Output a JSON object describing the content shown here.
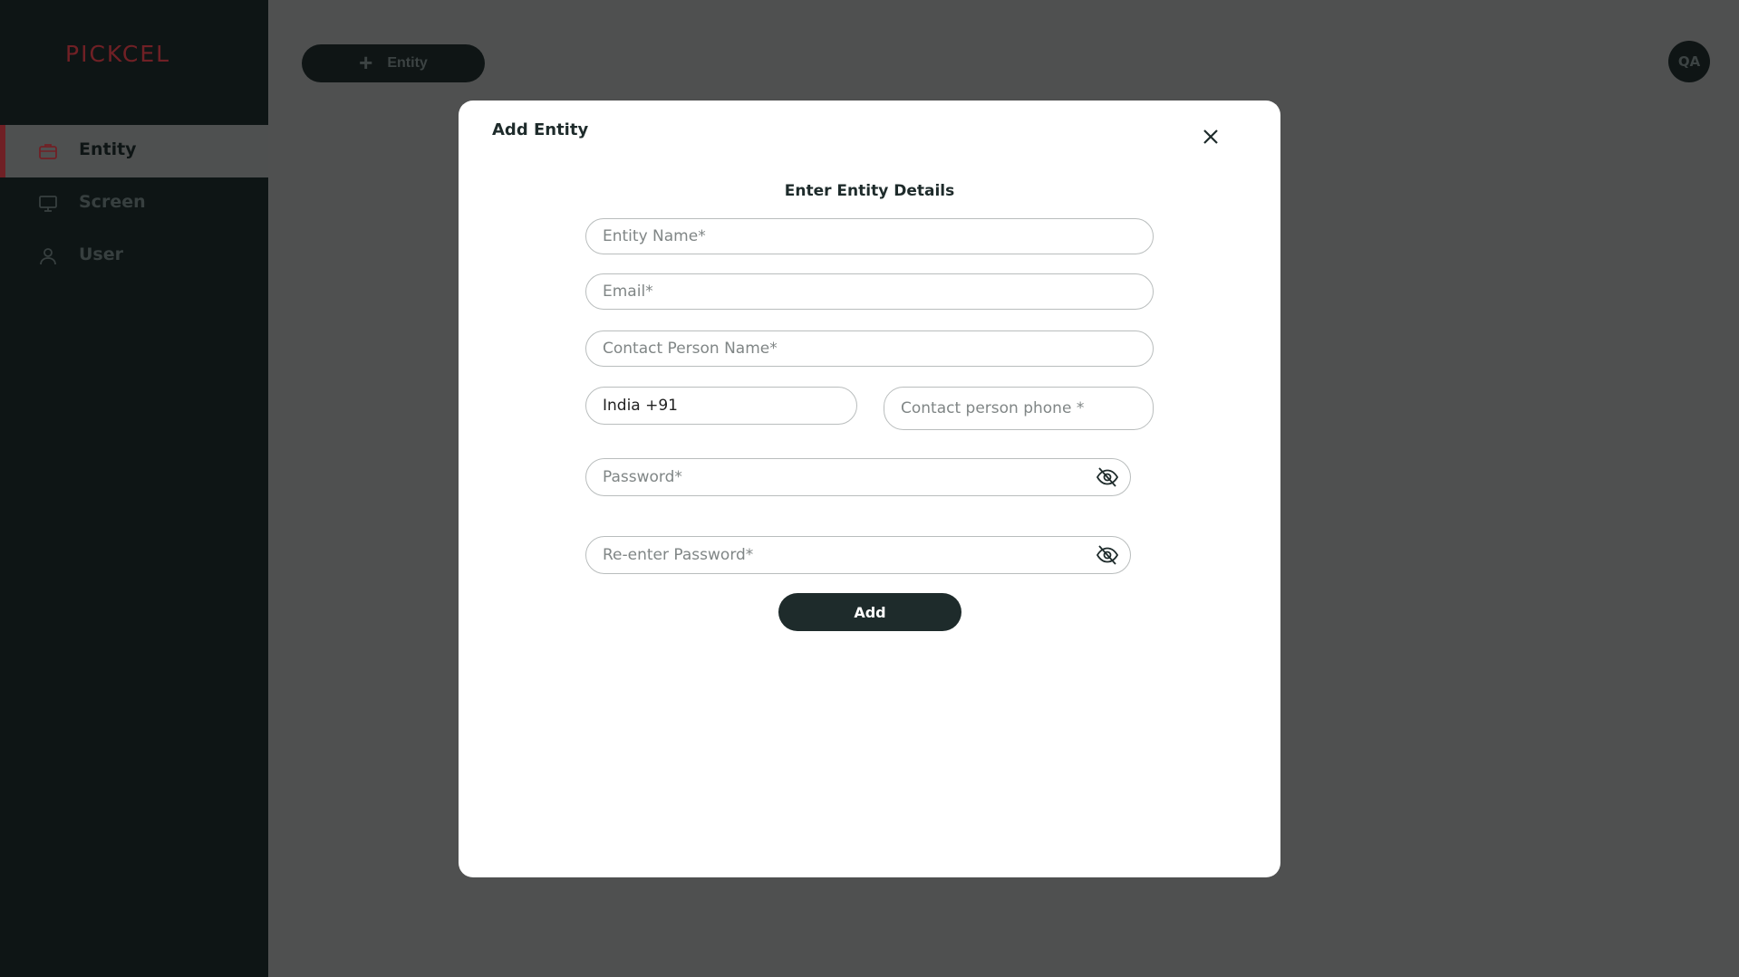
{
  "app": {
    "logo_text": "PICKCEL"
  },
  "sidebar": {
    "items": [
      {
        "label": "Entity",
        "icon": "briefcase-icon",
        "active": true
      },
      {
        "label": "Screen",
        "icon": "monitor-icon",
        "active": false
      },
      {
        "label": "User",
        "icon": "user-icon",
        "active": false
      }
    ]
  },
  "header": {
    "add_button_label": "Entity",
    "avatar_initials": "QA"
  },
  "modal": {
    "title": "Add Entity",
    "section_title": "Enter Entity Details",
    "fields": {
      "entity_name_placeholder": "Entity Name*",
      "email_placeholder": "Email*",
      "contact_person_placeholder": "Contact Person Name*",
      "country_code_value": "India +91",
      "phone_placeholder": "Contact person phone *",
      "password_placeholder": "Password*",
      "reenter_password_placeholder": "Re-enter Password*"
    },
    "submit_label": "Add"
  },
  "colors": {
    "brand_red": "#e1404b",
    "dark": "#1e2b2b"
  }
}
